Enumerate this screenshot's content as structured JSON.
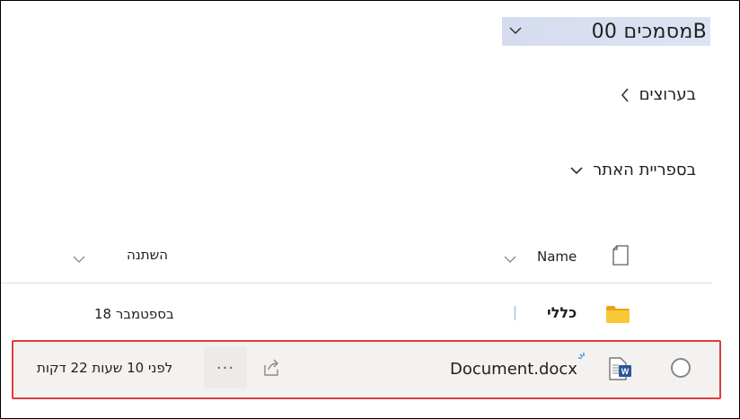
{
  "library": {
    "title": "מסמכים 00B",
    "dropdown_icon": "chevron-down-icon"
  },
  "sections": [
    {
      "label": "בערוצים",
      "icon": "chevron-left-icon",
      "expanded": false
    },
    {
      "label": "בספריית האתר",
      "icon": "chevron-down-icon",
      "expanded": true
    }
  ],
  "columns": {
    "file_type_icon": "document-icon",
    "name": "Name",
    "modified": "השתנה"
  },
  "rows": [
    {
      "type": "folder",
      "name": "כללי",
      "modified": "18 בספטמבר",
      "icon": "folder-icon"
    },
    {
      "type": "file",
      "name": "Document.docx",
      "modified": "לפני 10 שעות 22 דקות",
      "icon": "word-document-icon",
      "more": "···",
      "selected": true
    }
  ],
  "colors": {
    "accent": "#2b579a",
    "folder": "#f8c935",
    "highlight_border": "#e03c3c",
    "title_bg": "#d5dcee"
  }
}
